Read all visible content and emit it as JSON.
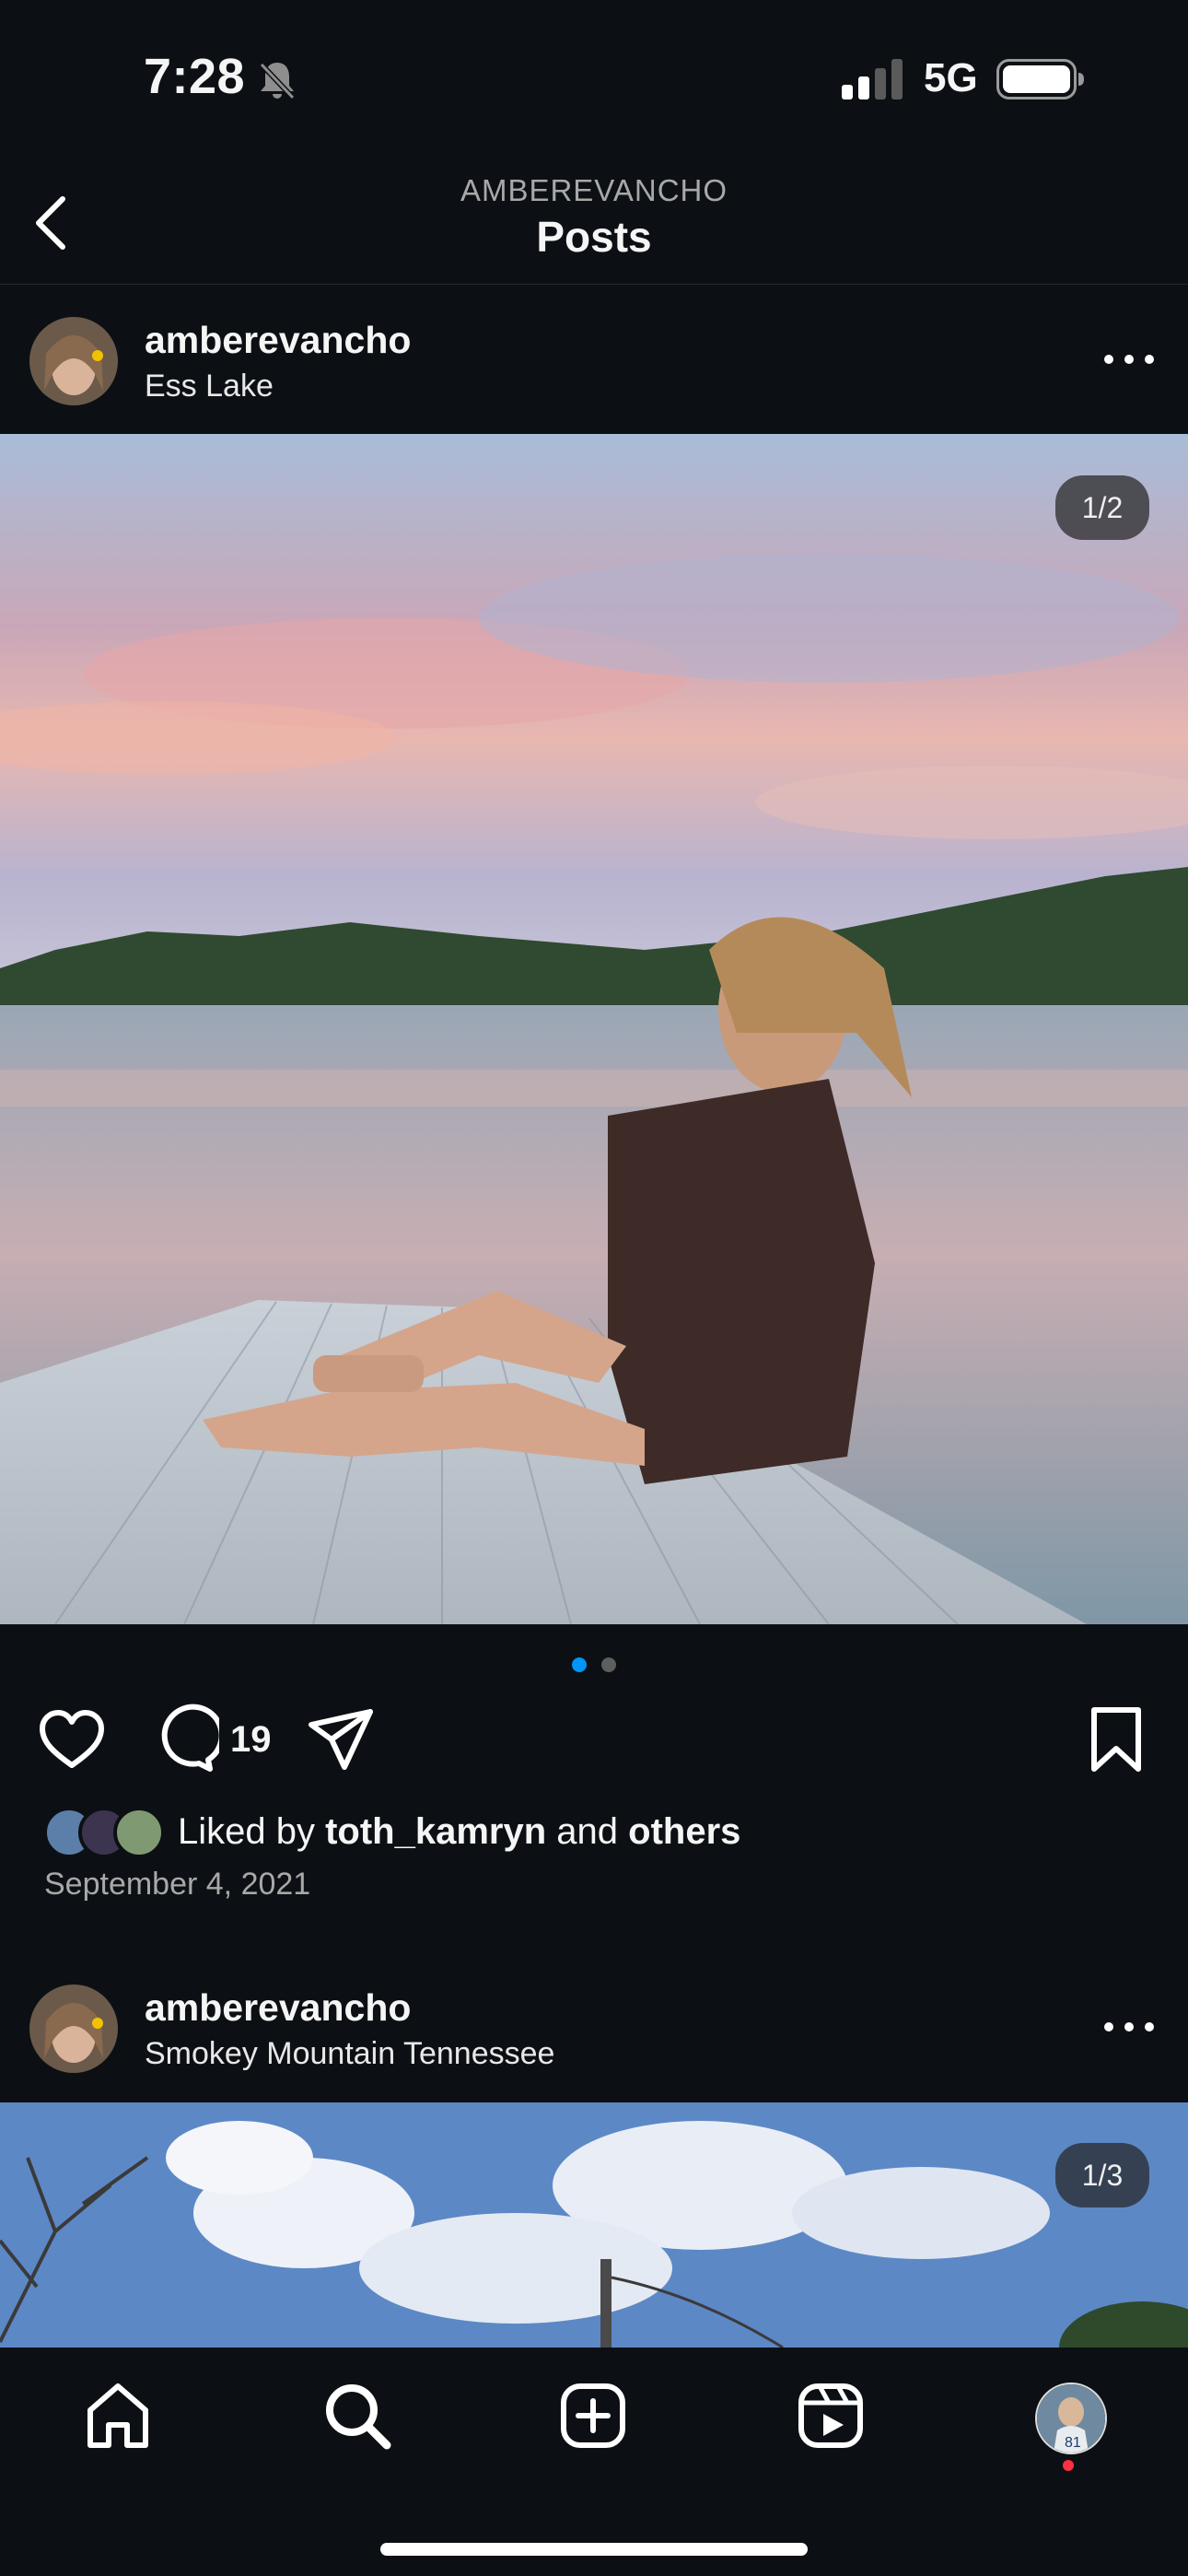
{
  "status_bar": {
    "time": "7:28",
    "network": "5G",
    "bell_icon": "bell-slash-icon",
    "signal_icon": "signal-icon",
    "battery_icon": "battery-icon"
  },
  "header": {
    "username": "AMBEREVANCHO",
    "title": "Posts",
    "back_icon": "chevron-left-icon"
  },
  "posts": [
    {
      "username": "amberevancho",
      "location": "Ess Lake",
      "image_counter": "1/2",
      "carousel_dots": 2,
      "carousel_active": 0,
      "comment_count": "19",
      "liked_by_prefix": "Liked by",
      "liked_by_user": "toth_kamryn",
      "liked_by_joiner": "and",
      "liked_by_others": "others",
      "date": "September 4, 2021"
    },
    {
      "username": "amberevancho",
      "location": "Smokey Mountain Tennessee",
      "image_counter": "1/3"
    }
  ],
  "tab_bar": {
    "items": [
      "home-icon",
      "search-icon",
      "create-icon",
      "reels-icon",
      "profile-avatar"
    ],
    "notification_color": "#ff3040"
  },
  "colors": {
    "background": "#0c1014",
    "accent": "#0095f6",
    "muted": "#a8a8a8"
  }
}
